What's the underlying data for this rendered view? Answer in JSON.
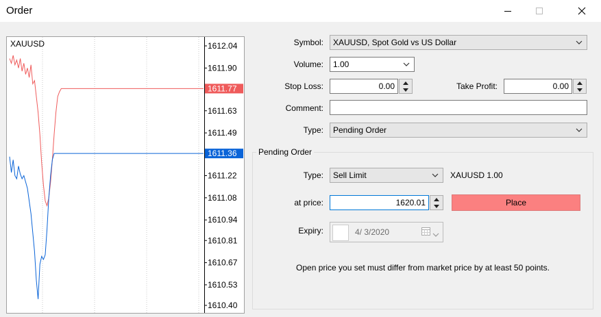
{
  "window": {
    "title": "Order"
  },
  "chart": {
    "symbol": "XAUUSD",
    "price_ticks": [
      "1612.04",
      "1611.90",
      "1611.77",
      "1611.63",
      "1611.49",
      "1611.36",
      "1611.22",
      "1611.08",
      "1610.94",
      "1610.81",
      "1610.67",
      "1610.53",
      "1610.40"
    ],
    "ask_price": "1611.77",
    "bid_price": "1611.36",
    "ask_color": "#ef5b5b",
    "bid_color": "#0a64d8"
  },
  "chart_data": {
    "type": "line",
    "title": "XAUUSD",
    "ylim": [
      1610.4,
      1612.04
    ],
    "series": [
      {
        "values": [
          1611.96,
          1611.93,
          1611.98,
          1611.92,
          1611.95,
          1611.9,
          1611.96,
          1611.88,
          1611.93,
          1611.86,
          1611.9,
          1611.84,
          1611.92,
          1611.8,
          1611.82,
          1611.72,
          1611.62,
          1611.48,
          1611.3,
          1611.16,
          1611.06,
          1611.03,
          1611.08,
          1611.18,
          1611.32,
          1611.48,
          1611.62,
          1611.72,
          1611.75,
          1611.77,
          1611.77,
          1611.77,
          1611.77,
          1611.77,
          1611.77,
          1611.77,
          1611.77
        ]
      },
      {
        "values": [
          1611.34,
          1611.24,
          1611.32,
          1611.22,
          1611.2,
          1611.28,
          1611.23,
          1611.2,
          1611.22,
          1611.18,
          1611.14,
          1611.06,
          1610.98,
          1610.86,
          1610.74,
          1610.56,
          1610.44,
          1610.66,
          1610.71,
          1610.69,
          1610.72,
          1610.88,
          1611.08,
          1611.22,
          1611.32,
          1611.36,
          1611.36,
          1611.36,
          1611.36,
          1611.36,
          1611.36,
          1611.36,
          1611.36,
          1611.36,
          1611.36,
          1611.36,
          1611.36
        ]
      }
    ]
  },
  "form": {
    "symbol_label": "Symbol:",
    "symbol_value": "XAUUSD, Spot Gold vs US Dollar",
    "volume_label": "Volume:",
    "volume_value": "1.00",
    "stop_loss_label": "Stop Loss:",
    "stop_loss_value": "0.00",
    "take_profit_label": "Take Profit:",
    "take_profit_value": "0.00",
    "comment_label": "Comment:",
    "comment_value": "",
    "type_label": "Type:",
    "type_value": "Pending Order"
  },
  "pending": {
    "group_title": "Pending Order",
    "type_label": "Type:",
    "type_value": "Sell Limit",
    "info": "XAUUSD 1.00",
    "price_label": "at price:",
    "price_value": "1620.01",
    "place_label": "Place",
    "place_color": "#fb8080",
    "expiry_label": "Expiry:",
    "expiry_value": "4/  3/2020",
    "note": "Open price you set must differ from market price by at least 50 points."
  }
}
